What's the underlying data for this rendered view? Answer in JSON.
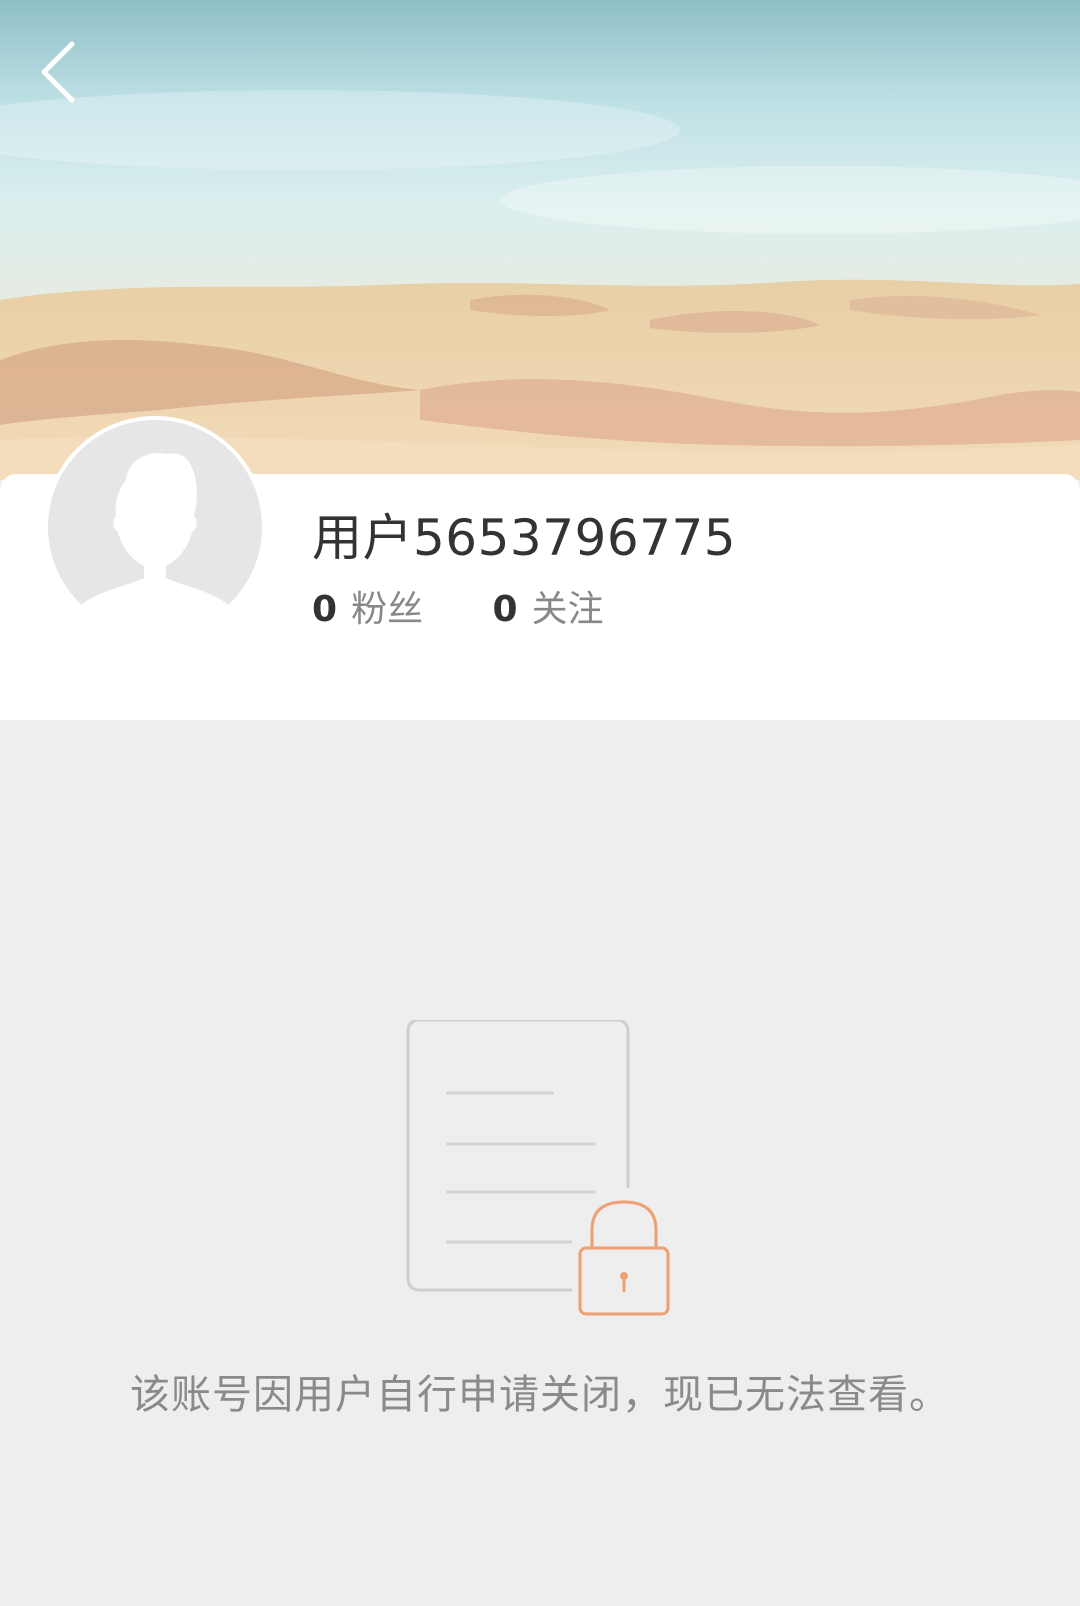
{
  "header": {
    "back_icon": "chevron-left-icon"
  },
  "profile": {
    "username": "用户5653796775",
    "followers_count": "0",
    "followers_label": "粉丝",
    "following_count": "0",
    "following_label": "关注",
    "avatar_icon": "default-avatar-icon"
  },
  "empty_state": {
    "icon": "locked-document-icon",
    "message": "该账号因用户自行申请关闭，现已无法查看。",
    "accent_color": "#f0a070"
  }
}
